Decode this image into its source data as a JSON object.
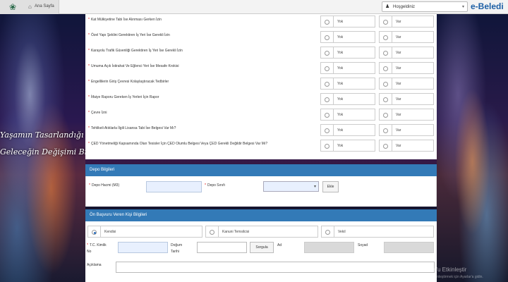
{
  "topbar": {
    "home_label": "Ana Sayfa",
    "welcome_label": "Hoşgeldiniz",
    "brand": "e-Beledi"
  },
  "background": {
    "slogan_line1": "Yaşamın Tasarlandığı",
    "slogan_line2": "Geleceğin Değişimi Bir Ken"
  },
  "permits": {
    "option_no": "Yok",
    "option_yes": "Var",
    "rows": [
      {
        "label": "Kat Mülkiyetine Tabi İse Alınması Gerken İzin"
      },
      {
        "label": "Özel Yapı Şeklini Gerektiren İş Yeri İse Gerekli İzin"
      },
      {
        "label": "Karayolu Trafik Güvenliği Gerektiren İş Yeri İse Gerekli İzin"
      },
      {
        "label": "Umuma Açık İstirahat Ve Eğlenci Yeri İse Mesafe Krokisi"
      },
      {
        "label": "Engellilerin Giriş Çevresi Kolaylaştıracak Tedbirler"
      },
      {
        "label": "İtfaiye Raporu Gereken İş Yerleri İçin Rapor"
      },
      {
        "label": "Çevre İzni"
      },
      {
        "label": "Tehlikeli Atıklarla İlgili Lisansa Tabi İse Belgesi Var Mı?"
      },
      {
        "label": "ÇED Yönetmeliği Kapsamında Olan Tesisler İçin ÇED Olumlu Belgesi Veya ÇED Gerekli Değildir Belgesi Var Mı?"
      }
    ]
  },
  "depot": {
    "title": "Depo Bilgileri",
    "volume_label": "Depo Hacmi (M3)",
    "volume_value": "",
    "class_label": "Depo Sınıfı",
    "class_value": "",
    "add_button": "Ekle"
  },
  "applicant": {
    "title": "Ön Başvuru Veren Kişi Bilgileri",
    "options": [
      "Kendisi",
      "Kanuni Temsilcisi",
      "Vekil"
    ],
    "selected": "Kendisi",
    "tc_label": "T.C. Kimlik No",
    "tc_value": "",
    "birth_label": "Doğum Tarihi",
    "birth_value": "",
    "query_button": "Sorgula",
    "name_label": "Ad",
    "name_value": "",
    "surname_label": "Soyad",
    "surname_value": "",
    "description_label": "Açıklama",
    "description_value": ""
  },
  "watermark": {
    "line1": "Windows'u Etkinleştir",
    "line2": "Windows'u etkinleştirmek için Ayarlar'a gidin."
  },
  "colors": {
    "header_blue": "#337ab7",
    "brand_blue": "#1c5fa5",
    "required_red": "#dd0000"
  }
}
